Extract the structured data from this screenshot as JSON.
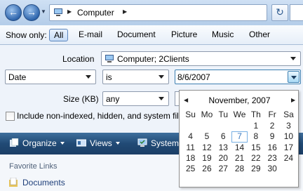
{
  "address": {
    "path": "Computer"
  },
  "filter_bar": {
    "label": "Show only:",
    "items": [
      "All",
      "E-mail",
      "Document",
      "Picture",
      "Music",
      "Other"
    ],
    "active": "All"
  },
  "search_pane": {
    "location_label": "Location",
    "location_value": "Computer; 2Clients",
    "field_value": "Date",
    "operator_value": "is",
    "date_value": "8/6/2007",
    "size_label": "Size (KB)",
    "size_operator": "any",
    "checkbox_label": "Include non-indexed, hidden, and system files"
  },
  "toolbar": {
    "organize": "Organize",
    "views": "Views",
    "system": "System"
  },
  "nav_pane": {
    "heading": "Favorite Links",
    "link": "Documents"
  },
  "calendar": {
    "title": "November, 2007",
    "weekdays": [
      "Su",
      "Mo",
      "Tu",
      "We",
      "Th",
      "Fr",
      "Sa"
    ],
    "weeks": [
      [
        "",
        "",
        "",
        "",
        "1",
        "2",
        "3"
      ],
      [
        "4",
        "5",
        "6",
        "7",
        "8",
        "9",
        "10"
      ],
      [
        "11",
        "12",
        "13",
        "14",
        "15",
        "16",
        "17"
      ],
      [
        "18",
        "19",
        "20",
        "21",
        "22",
        "23",
        "24"
      ],
      [
        "25",
        "26",
        "27",
        "28",
        "29",
        "30",
        ""
      ]
    ],
    "today": "7"
  },
  "colors": {
    "toolbar_bg": "#214a75",
    "link": "#1e3f7a",
    "today_border": "#79b0e3"
  },
  "icons": [
    "back-arrow-icon",
    "forward-arrow-icon",
    "computer-icon",
    "refresh-icon",
    "organize-icon",
    "views-icon",
    "system-icon",
    "documents-folder-icon"
  ]
}
